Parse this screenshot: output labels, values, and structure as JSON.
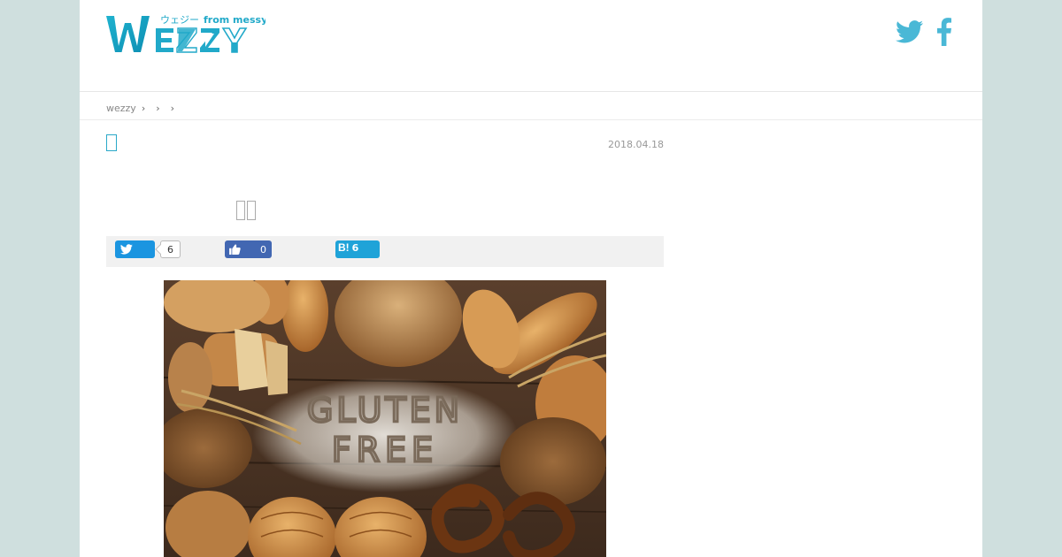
{
  "header": {
    "logo_text": "WEZZY",
    "logo_tagline_kana": "ウェジー",
    "logo_tagline_en": "from messy",
    "social_icons": [
      "twitter-icon",
      "facebook-icon"
    ]
  },
  "breadcrumb": {
    "items": [
      "wezzy",
      "",
      "",
      ""
    ],
    "separator": "›"
  },
  "article": {
    "date": "2018.04.18",
    "image_text": [
      "GLUTEN",
      "FREE"
    ]
  },
  "share": {
    "twitter_count": "6",
    "facebook_count": "0",
    "hatena_label": "B!",
    "hatena_count": "6"
  },
  "colors": {
    "accent": "#2aa8c8",
    "twitter": "#1b95e0",
    "facebook": "#4267b2",
    "hatena": "#1fa3d8",
    "side_bg": "#cfdfde",
    "share_bar": "#f1f1f1"
  }
}
